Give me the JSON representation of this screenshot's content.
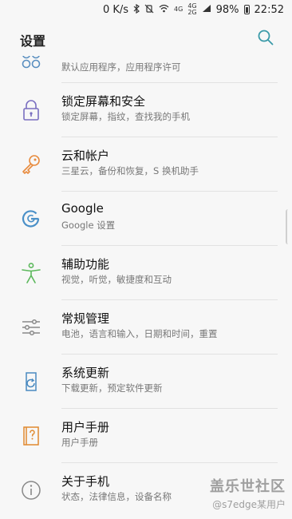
{
  "status_bar": {
    "net_speed": "0 K/s",
    "bluetooth_icon": "bluetooth-icon",
    "mute_icon": "vibrate-mute-icon",
    "wifi_icon": "wifi-icon",
    "net_1": "4G",
    "net_2": "4G",
    "net_3": "2G",
    "battery": "98%",
    "time": "22:52"
  },
  "app_bar": {
    "title": "设置",
    "search_icon": "search-icon"
  },
  "settings": [
    {
      "name": "apps",
      "icon": "apps-icon",
      "title": "",
      "sub": "默认应用程序，应用程序许可"
    },
    {
      "name": "lock-screen-security",
      "icon": "lock-icon",
      "title": "锁定屏幕和安全",
      "sub": "锁定屏幕，指纹，查找我的手机"
    },
    {
      "name": "cloud-accounts",
      "icon": "key-icon",
      "title": "云和帐户",
      "sub": "三星云，备份和恢复，S 换机助手"
    },
    {
      "name": "google",
      "icon": "google-icon",
      "title": "Google",
      "sub": "Google 设置"
    },
    {
      "name": "accessibility",
      "icon": "accessibility-icon",
      "title": "辅助功能",
      "sub": "视觉，听觉，敏捷度和互动"
    },
    {
      "name": "general-management",
      "icon": "sliders-icon",
      "title": "常规管理",
      "sub": "电池，语言和输入，日期和时间，重置"
    },
    {
      "name": "software-update",
      "icon": "update-icon",
      "title": "系统更新",
      "sub": "下载更新，预定软件更新"
    },
    {
      "name": "user-manual",
      "icon": "manual-icon",
      "title": "用户手册",
      "sub": "用户手册"
    },
    {
      "name": "about-phone",
      "icon": "info-icon",
      "title": "关于手机",
      "sub": "状态，法律信息，设备名称"
    }
  ],
  "watermark": {
    "title": "盖乐世社区",
    "user": "@s7edge某用户"
  },
  "colors": {
    "accent_teal": "#3a9aa8",
    "lock_purple": "#7a6fc0",
    "key_orange": "#e88b3e",
    "google_blue": "#4a90c8",
    "access_green": "#5cb85c",
    "update_blue": "#4a8ac0",
    "manual_orange": "#e0892f"
  }
}
